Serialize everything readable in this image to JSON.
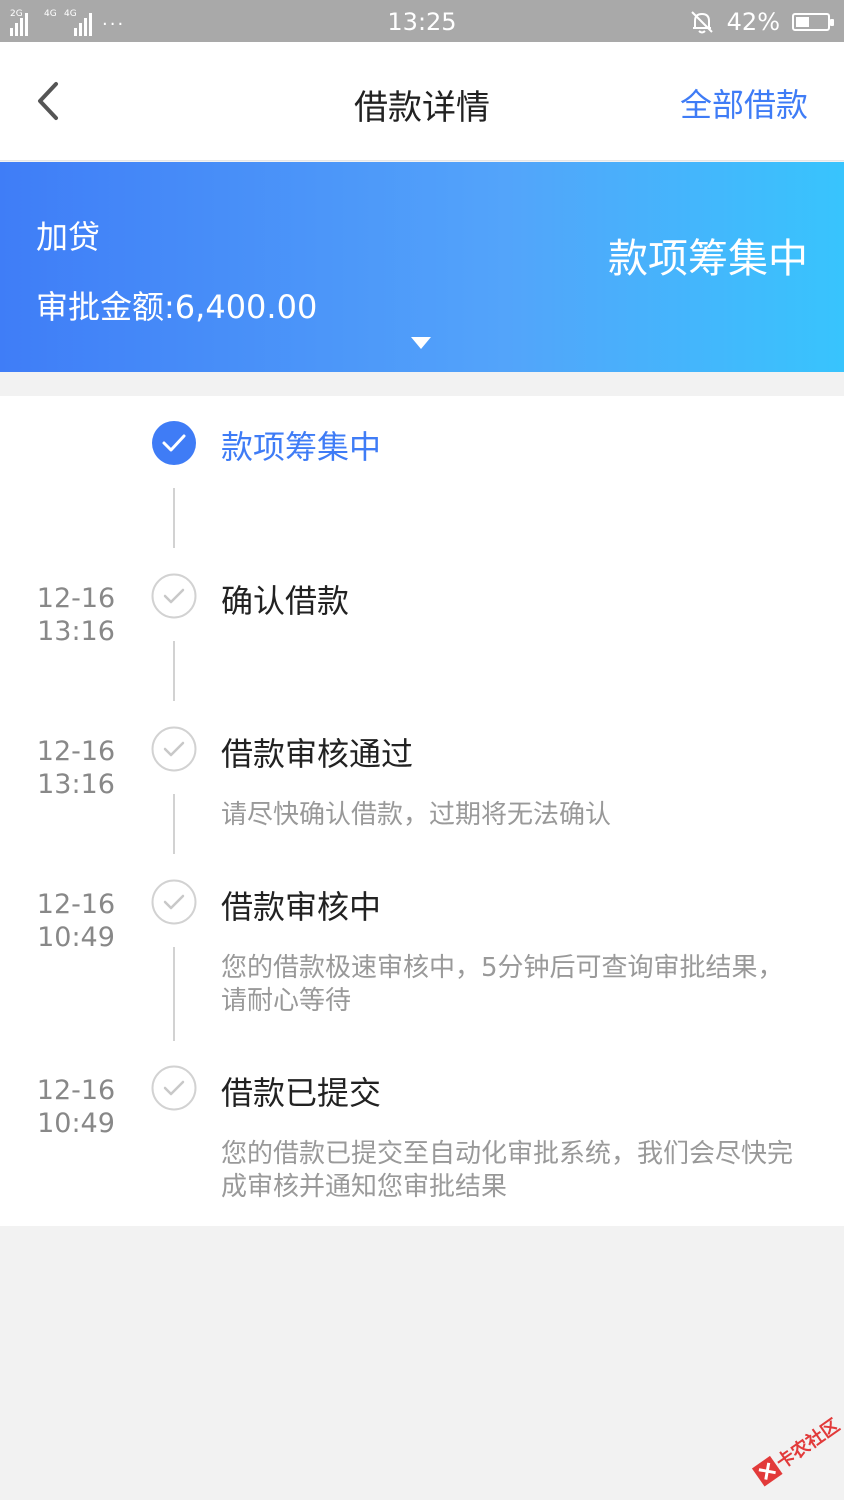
{
  "status_bar": {
    "signal_1_label": "2G",
    "signal_2_label": "4G",
    "signal_2_sublabel": "4G",
    "more": "···",
    "time": "13:25",
    "battery": "42%",
    "battery_level": 0.42,
    "icons": [
      "signal-icon",
      "mute-bell-icon",
      "battery-icon"
    ]
  },
  "header": {
    "title": "借款详情",
    "back_icon": "chevron-left-icon",
    "right_link": "全部借款"
  },
  "banner": {
    "loan_type": "加贷",
    "amount_label": "审批金额:",
    "amount_value": "6,400.00",
    "status": "款项筹集中",
    "toggle_icon": "triangle-down-icon"
  },
  "colors": {
    "accent": "#3f7cf6",
    "banner_start": "#3f7df7",
    "banner_end": "#38c4fd",
    "text_primary": "#222222",
    "text_secondary": "#999999"
  },
  "timeline": [
    {
      "date": "",
      "time": "",
      "title": "款项筹集中",
      "desc": "",
      "state": "active"
    },
    {
      "date": "12-16",
      "time": "13:16",
      "title": "确认借款",
      "desc": "",
      "state": "done"
    },
    {
      "date": "12-16",
      "time": "13:16",
      "title": "借款审核通过",
      "desc": "请尽快确认借款，过期将无法确认",
      "state": "done"
    },
    {
      "date": "12-16",
      "time": "10:49",
      "title": "借款审核中",
      "desc": "您的借款极速审核中，5分钟后可查询审批结果，请耐心等待",
      "state": "done"
    },
    {
      "date": "12-16",
      "time": "10:49",
      "title": "借款已提交",
      "desc": "您的借款已提交至自动化审批系统，我们会尽快完成审核并通知您审批结果",
      "state": "done"
    }
  ],
  "watermark": {
    "text": "卡农社区",
    "icon": "kanong-logo-icon"
  }
}
